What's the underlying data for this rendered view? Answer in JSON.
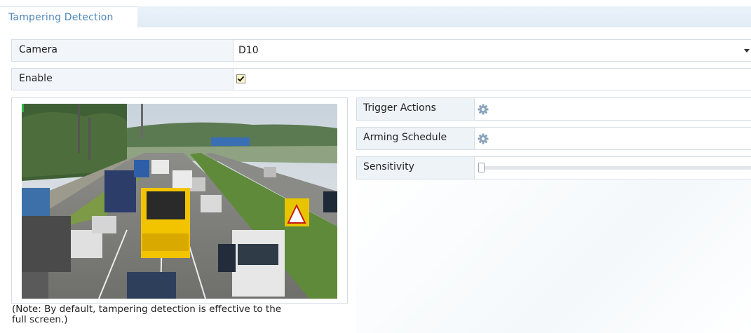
{
  "tab": {
    "label": "Tampering Detection"
  },
  "camera": {
    "label": "Camera",
    "value": "D10"
  },
  "enable": {
    "label": "Enable",
    "checked": true
  },
  "note": {
    "line1": "(Note: By default, tampering detection is effective to the",
    "line2": "full screen.)"
  },
  "panel": {
    "trigger_actions": {
      "label": "Trigger Actions",
      "icon": "gear-icon"
    },
    "arming_schedule": {
      "label": "Arming Schedule",
      "icon": "gear-icon"
    },
    "sensitivity": {
      "label": "Sensitivity",
      "level": 0
    }
  },
  "colors": {
    "accent": "#4d86b8",
    "checkbox_fill": "#fff7c9"
  }
}
